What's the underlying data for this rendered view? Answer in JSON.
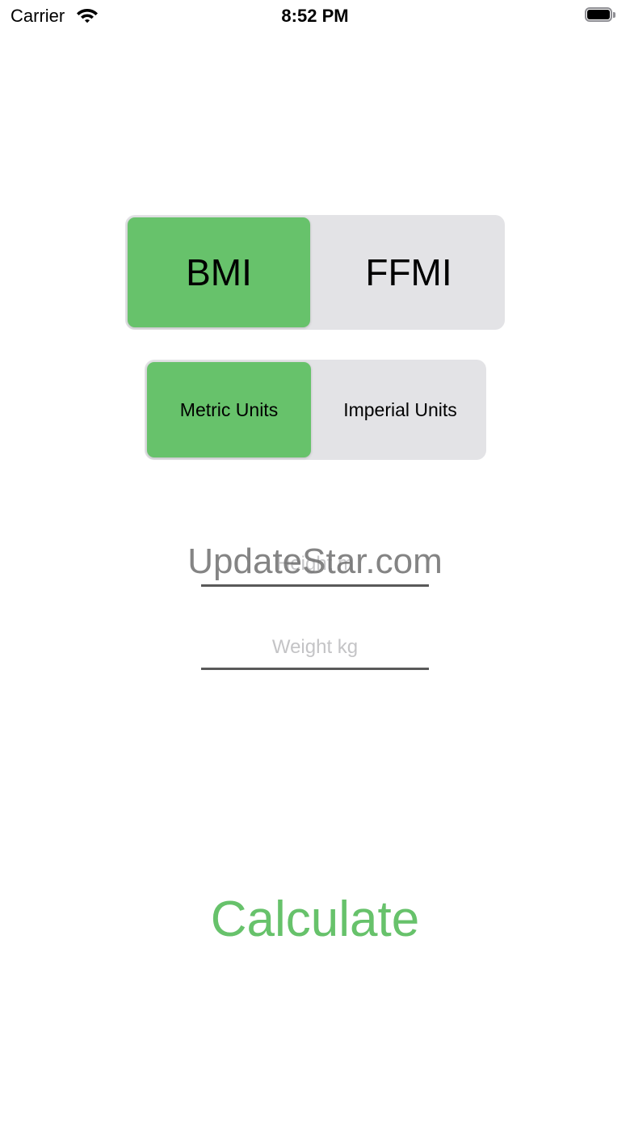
{
  "status_bar": {
    "carrier": "Carrier",
    "time": "8:52 PM"
  },
  "colors": {
    "accent": "#67c26b",
    "segment_bg": "#e3e3e6",
    "placeholder": "#c4c4c6",
    "underline": "#595959"
  },
  "index_type": {
    "options": [
      "BMI",
      "FFMI"
    ],
    "selected": "BMI"
  },
  "units": {
    "options": [
      "Metric Units",
      "Imperial Units"
    ],
    "selected": "Metric Units"
  },
  "height_field": {
    "placeholder": "Height m",
    "value": ""
  },
  "weight_field": {
    "placeholder": "Weight kg",
    "value": ""
  },
  "calculate_label": "Calculate",
  "watermark": "UpdateStar.com"
}
